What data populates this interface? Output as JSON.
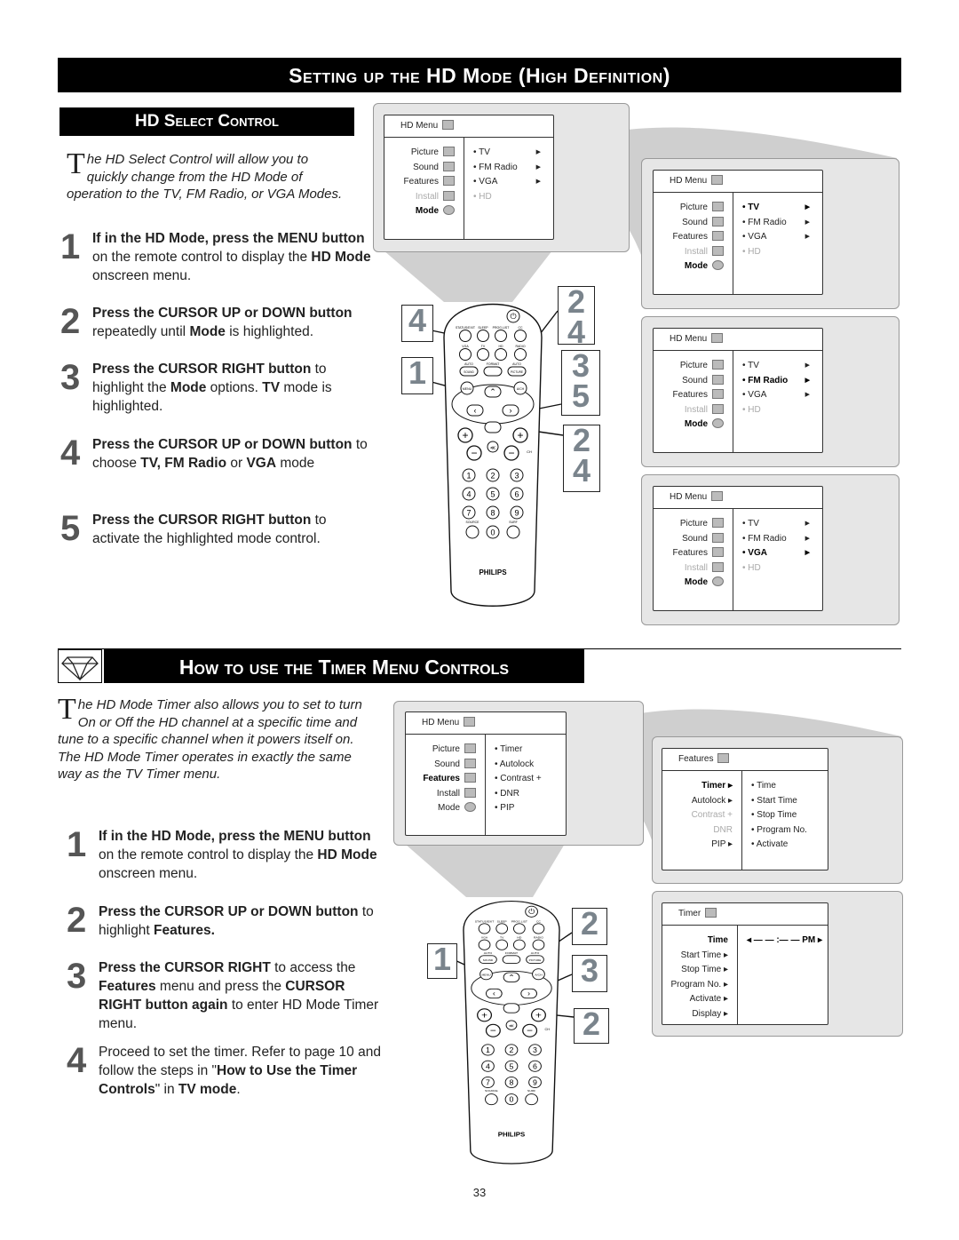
{
  "title": "Setting up the HD Mode (High Definition)",
  "section1": {
    "heading": "HD Select Control",
    "intro_cap": "T",
    "intro": "he HD Select Control will allow you to quickly change from the HD Mode of operation to the TV, FM Radio, or VGA Modes.",
    "steps": [
      {
        "num": "1",
        "html": "<b>If in the HD Mode, press the MENU</b> <b>button</b> on the remote control to display the <b>HD Mode</b> onscreen menu."
      },
      {
        "num": "2",
        "html": "<b>Press the CURSOR UP or DOWN</b> <b>button</b> repeatedly until <b>Mode</b> is highlighted."
      },
      {
        "num": "3",
        "html": "<b>Press the CURSOR RIGHT button</b> to highlight the <b>Mode</b> options. <b>TV</b> mode is highlighted."
      },
      {
        "num": "4",
        "html": "<b>Press the CURSOR UP or DOWN</b> <b>button</b> to choose <b>TV, FM Radio</b> or <b>VGA</b> mode"
      },
      {
        "num": "5",
        "html": "<b>Press the CURSOR RIGHT button</b> to activate the highlighted mode control."
      }
    ],
    "callouts": [
      "4",
      "1",
      "2\n4",
      "3\n5",
      "2\n4"
    ],
    "menus": [
      {
        "title": "HD Menu",
        "left": [
          {
            "label": "Picture",
            "s": ""
          },
          {
            "label": "Sound",
            "s": ""
          },
          {
            "label": "Features",
            "s": ""
          },
          {
            "label": "Install",
            "s": "dim"
          },
          {
            "label": "Mode",
            "s": "bold",
            "round": true
          }
        ],
        "right": [
          {
            "label": "• TV",
            "s": "",
            "arrow": "▶"
          },
          {
            "label": "• FM Radio",
            "s": "",
            "arrow": "▶"
          },
          {
            "label": "• VGA",
            "s": "",
            "arrow": "▶"
          },
          {
            "label": "• HD",
            "s": "dim"
          }
        ]
      },
      {
        "title": "HD Menu",
        "left": [
          {
            "label": "Picture",
            "s": ""
          },
          {
            "label": "Sound",
            "s": ""
          },
          {
            "label": "Features",
            "s": ""
          },
          {
            "label": "Install",
            "s": "dim"
          },
          {
            "label": "Mode",
            "s": "bold",
            "round": true
          }
        ],
        "right": [
          {
            "label": "• TV",
            "s": "bold",
            "arrow": "▶"
          },
          {
            "label": "• FM Radio",
            "s": "",
            "arrow": "▶"
          },
          {
            "label": "• VGA",
            "s": "",
            "arrow": "▶"
          },
          {
            "label": "• HD",
            "s": "dim"
          }
        ]
      },
      {
        "title": "HD Menu",
        "left": [
          {
            "label": "Picture",
            "s": ""
          },
          {
            "label": "Sound",
            "s": ""
          },
          {
            "label": "Features",
            "s": ""
          },
          {
            "label": "Install",
            "s": "dim"
          },
          {
            "label": "Mode",
            "s": "bold",
            "round": true
          }
        ],
        "right": [
          {
            "label": "• TV",
            "s": "",
            "arrow": "▶"
          },
          {
            "label": "• FM Radio",
            "s": "bold",
            "arrow": "▶"
          },
          {
            "label": "• VGA",
            "s": "",
            "arrow": "▶"
          },
          {
            "label": "• HD",
            "s": "dim"
          }
        ]
      },
      {
        "title": "HD Menu",
        "left": [
          {
            "label": "Picture",
            "s": ""
          },
          {
            "label": "Sound",
            "s": ""
          },
          {
            "label": "Features",
            "s": ""
          },
          {
            "label": "Install",
            "s": "dim"
          },
          {
            "label": "Mode",
            "s": "bold",
            "round": true
          }
        ],
        "right": [
          {
            "label": "• TV",
            "s": "",
            "arrow": "▶"
          },
          {
            "label": "• FM Radio",
            "s": "",
            "arrow": "▶"
          },
          {
            "label": "• VGA",
            "s": "bold",
            "arrow": "▶"
          },
          {
            "label": "• HD",
            "s": "dim"
          }
        ]
      }
    ]
  },
  "section2": {
    "heading": "How to use the  Timer Menu Controls",
    "intro_cap": "T",
    "intro": "he HD Mode Timer also allows you to set to turn On or Off the HD channel at a specific time and tune to a specific channel when it powers itself on. The HD Mode Timer operates in exactly the same way as the TV Timer menu.",
    "steps": [
      {
        "num": "1",
        "html": "<b>If in the HD Mode, press the MENU</b> <b>button</b> on the remote control to display the <b>HD Mode</b> onscreen menu."
      },
      {
        "num": "2",
        "html": "<b>Press the CURSOR UP or DOWN</b> <b>button</b> to highlight <b>Features.</b>"
      },
      {
        "num": "3",
        "html": "<b>Press the CURSOR RIGHT</b> to access the <b>Features</b> menu and press the <b>CURSOR RIGHT button again</b> to enter HD Mode Timer menu."
      },
      {
        "num": "4",
        "html": "Proceed to set the timer. Refer to page 10 and follow the steps in \"<b>How to Use the Timer Controls</b>\" in <b>TV mode</b>."
      }
    ],
    "callouts": [
      "1",
      "2",
      "3",
      "2"
    ],
    "menus": [
      {
        "title": "HD Menu",
        "left": [
          {
            "label": "Picture",
            "s": ""
          },
          {
            "label": "Sound",
            "s": ""
          },
          {
            "label": "Features",
            "s": "bold"
          },
          {
            "label": "Install",
            "s": ""
          },
          {
            "label": "Mode",
            "s": "",
            "round": true
          }
        ],
        "right": [
          {
            "label": "• Timer",
            "s": ""
          },
          {
            "label": "• Autolock",
            "s": ""
          },
          {
            "label": "• Contrast +",
            "s": ""
          },
          {
            "label": "• DNR",
            "s": ""
          },
          {
            "label": "• PIP",
            "s": ""
          }
        ]
      },
      {
        "title": "Features",
        "left": [
          {
            "label": "Timer ▸",
            "s": "bold",
            "noicon": true
          },
          {
            "label": "Autolock ▸",
            "s": "",
            "noicon": true
          },
          {
            "label": "Contrast +",
            "s": "dim",
            "noicon": true
          },
          {
            "label": "DNR",
            "s": "dim",
            "noicon": true
          },
          {
            "label": "PIP ▸",
            "s": "",
            "noicon": true
          }
        ],
        "right": [
          {
            "label": "• Time",
            "s": ""
          },
          {
            "label": "• Start Time",
            "s": ""
          },
          {
            "label": "• Stop Time",
            "s": ""
          },
          {
            "label": "• Program No.",
            "s": ""
          },
          {
            "label": "• Activate",
            "s": ""
          }
        ]
      },
      {
        "title": "Timer",
        "left": [
          {
            "label": "Time",
            "s": "bold",
            "noicon": true
          },
          {
            "label": "Start Time ▸",
            "s": "",
            "noicon": true
          },
          {
            "label": "Stop Time ▸",
            "s": "",
            "noicon": true
          },
          {
            "label": "Program No. ▸",
            "s": "",
            "noicon": true
          },
          {
            "label": "Activate ▸",
            "s": "",
            "noicon": true
          },
          {
            "label": "Display ▸",
            "s": "",
            "noicon": true
          }
        ],
        "right": [
          {
            "label": "◂  — — :— — PM ▸",
            "s": "bold"
          }
        ]
      }
    ]
  },
  "remote": {
    "top_labels": [
      "STATUS/EXIT",
      "SLEEP",
      "PROG.LIST",
      "CC"
    ],
    "mid_labels": [
      "VGA",
      "TV",
      "HD",
      "RADIO"
    ],
    "auto_labels": [
      "AUTO",
      "FORMAT",
      "AUTO"
    ],
    "auto_buttons": [
      "SOUND",
      "",
      "PICTURE"
    ],
    "menu": "MENU",
    "ach": "A/CH",
    "digits": [
      "1",
      "2",
      "3",
      "4",
      "5",
      "6",
      "7",
      "8",
      "9",
      "0"
    ],
    "source": "SOURCE",
    "surf": "SURF",
    "ch": "CH",
    "brand": "PHILIPS"
  },
  "page_number": "33"
}
